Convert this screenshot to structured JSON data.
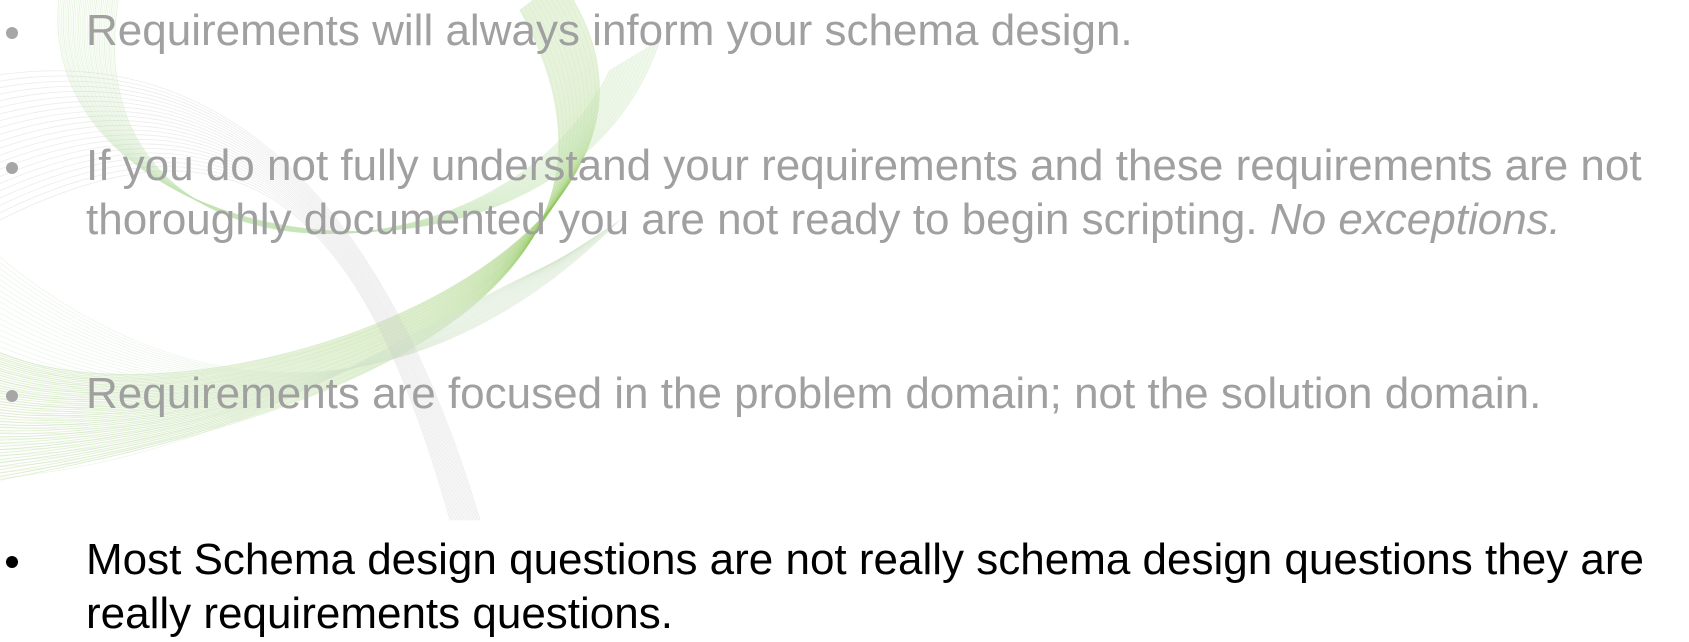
{
  "colors": {
    "faded_text": "#a0a0a0",
    "active_text": "#000000",
    "swirl": "#9ccc65",
    "background": "#ffffff"
  },
  "bullets": [
    {
      "text": "Requirements will always inform your schema design.",
      "state": "faded"
    },
    {
      "text": "If you do not fully understand your requirements and these requirements are not thoroughly documented you are not ready to begin scripting. ",
      "emphasis": "No exceptions.",
      "state": "faded"
    },
    {
      "text": "Requirements are focused in the problem domain; not the solution domain.",
      "state": "faded"
    },
    {
      "text": "Most Schema design questions are not really schema design questions they are really requirements questions.",
      "state": "active"
    }
  ],
  "decoration": {
    "icon": "green-swirl-lines"
  }
}
